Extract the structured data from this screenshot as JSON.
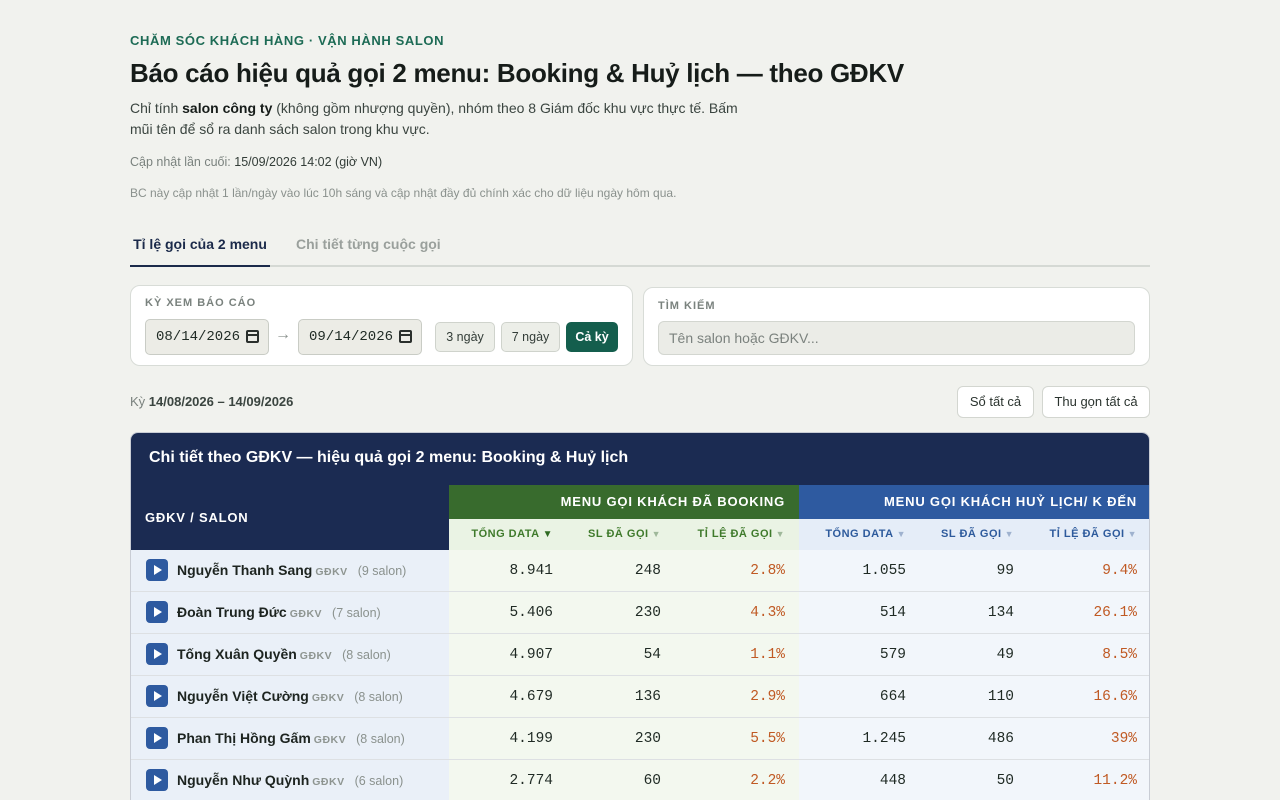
{
  "header": {
    "eyebrow": "CHĂM SÓC KHÁCH HÀNG · VẬN HÀNH SALON",
    "title": "Báo cáo hiệu quả gọi 2 menu: Booking & Huỷ lịch — theo GĐKV",
    "desc_prefix": "Chỉ tính ",
    "desc_bold": "salon công ty",
    "desc_suffix": " (không gồm nhượng quyền), nhóm theo 8 Giám đốc khu vực thực tế. Bấm mũi tên để sổ ra danh sách salon trong khu vực.",
    "updated_label": "Cập nhật lần cuối: ",
    "updated_value": "15/09/2026 14:02 (giờ VN)",
    "note": "BC này cập nhật 1 lần/ngày vào lúc 10h sáng và cập nhật đầy đủ chính xác cho dữ liệu ngày hôm qua."
  },
  "tabs": [
    {
      "label": "Tỉ lệ gọi của 2 menu",
      "active": true
    },
    {
      "label": "Chi tiết từng cuộc gọi",
      "active": false
    }
  ],
  "filters": {
    "period_label": "KỲ XEM BÁO CÁO",
    "date_from": "08/14/2026",
    "date_to": "09/14/2026",
    "arrow": "→",
    "quick": [
      "3 ngày",
      "7 ngày",
      "Cả kỳ"
    ],
    "search_label": "TÌM KIẾM",
    "search_placeholder": "Tên salon hoặc GĐKV..."
  },
  "summary": {
    "period_prefix": "Kỳ ",
    "period_value": "14/08/2026 – 14/09/2026",
    "expand_all": "Sổ tất cả",
    "collapse_all": "Thu gọn tất cả"
  },
  "table": {
    "title": "Chi tiết theo GĐKV — hiệu quả gọi 2 menu: Booking & Huỷ lịch",
    "col_name": "GĐKV / SALON",
    "group_booking": "MENU GỌI KHÁCH ĐÃ BOOKING",
    "group_cancel": "MENU GỌI KHÁCH HUỶ LỊCH/ K ĐẾN",
    "sub_total": "TỔNG DATA",
    "sub_called": "SL ĐÃ GỌI",
    "sub_rate": "TỈ LỆ ĐÃ GỌI",
    "sort_active": "▼",
    "sort_idle": "▼",
    "tag": "GĐKV",
    "rows": [
      {
        "name": "Nguyễn Thanh Sang",
        "count": "(9 salon)",
        "b_total": "8.941",
        "b_called": "248",
        "b_rate": "2.8%",
        "c_total": "1.055",
        "c_called": "99",
        "c_rate": "9.4%"
      },
      {
        "name": "Đoàn Trung Đức",
        "count": "(7 salon)",
        "b_total": "5.406",
        "b_called": "230",
        "b_rate": "4.3%",
        "c_total": "514",
        "c_called": "134",
        "c_rate": "26.1%"
      },
      {
        "name": "Tống Xuân Quyền",
        "count": "(8 salon)",
        "b_total": "4.907",
        "b_called": "54",
        "b_rate": "1.1%",
        "c_total": "579",
        "c_called": "49",
        "c_rate": "8.5%"
      },
      {
        "name": "Nguyễn Việt Cường",
        "count": "(8 salon)",
        "b_total": "4.679",
        "b_called": "136",
        "b_rate": "2.9%",
        "c_total": "664",
        "c_called": "110",
        "c_rate": "16.6%"
      },
      {
        "name": "Phan Thị Hồng Gấm",
        "count": "(8 salon)",
        "b_total": "4.199",
        "b_called": "230",
        "b_rate": "5.5%",
        "c_total": "1.245",
        "c_called": "486",
        "c_rate": "39%"
      },
      {
        "name": "Nguyễn Như Quỳnh",
        "count": "(6 salon)",
        "b_total": "2.774",
        "b_called": "60",
        "b_rate": "2.2%",
        "c_total": "448",
        "c_called": "50",
        "c_rate": "11.2%"
      }
    ]
  },
  "colors": {
    "navy": "#1b2b52",
    "green": "#386b2d",
    "blue": "#2e5aa0",
    "accent": "#145e4d",
    "rate": "#c05a24"
  }
}
